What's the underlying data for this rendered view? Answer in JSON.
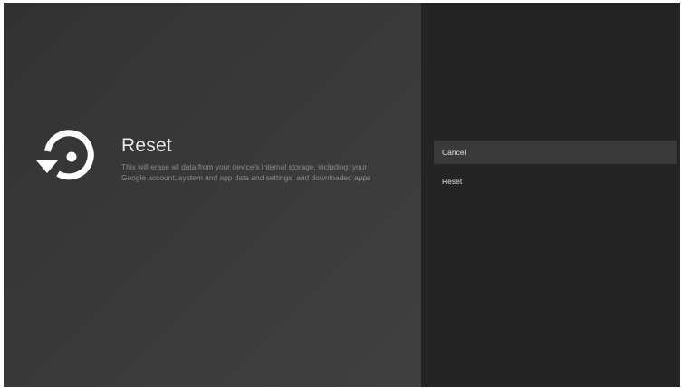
{
  "dialog": {
    "title": "Reset",
    "description": "This will erase all data from your device's internal storage, including: your Google account, system and app data and settings, and downloaded apps",
    "icon": "restore-icon"
  },
  "actions": [
    {
      "label": "Cancel",
      "selected": true
    },
    {
      "label": "Reset",
      "selected": false
    }
  ],
  "colors": {
    "left_background": "#383838",
    "right_background": "#242424",
    "selected_item": "#3a3a3a",
    "title_text": "#e8e8e8",
    "description_text": "#8c8c8c"
  }
}
